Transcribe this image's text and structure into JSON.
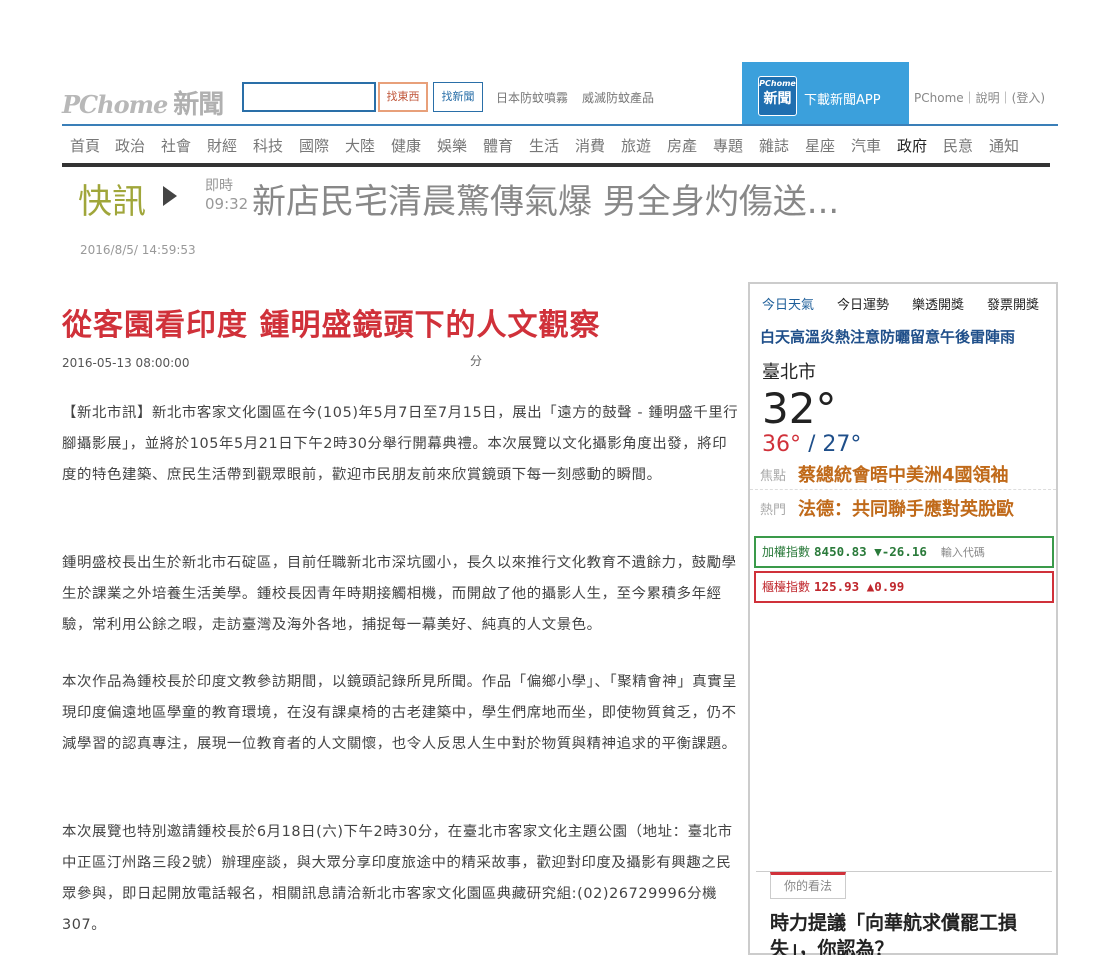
{
  "header": {
    "logo_text": "PChome",
    "logo_suffix": "新聞",
    "search_placeholder": "",
    "btn_shop": "找東西",
    "btn_news": "找新聞",
    "ad_links": [
      "日本防蚊噴霧",
      "威滅防蚊產品"
    ],
    "app_icon_top": "PChome",
    "app_icon_bottom": "新聞",
    "app_text": "下載新聞APP",
    "top_links": "PChome｜說明｜(登入)"
  },
  "nav": {
    "items": [
      "首頁",
      "政治",
      "社會",
      "財經",
      "科技",
      "國際",
      "大陸",
      "健康",
      "娛樂",
      "體育",
      "生活",
      "消費",
      "旅遊",
      "房產",
      "專題",
      "雜誌",
      "星座",
      "汽車",
      "政府",
      "民意",
      "通知"
    ],
    "active_index": 18
  },
  "flash": {
    "label": "快訊",
    "time_label": "即時",
    "time": "09:32",
    "headline": "新店民宅清晨驚傳氣爆 男全身灼傷送..."
  },
  "page_date": "2016/8/5/ 14:59:53",
  "article": {
    "title": "從客園看印度 鍾明盛鏡頭下的人文觀察",
    "date": "2016-05-13 08:00:00",
    "share_mark": "分",
    "paragraphs": [
      "【新北市訊】新北市客家文化園區在今(105)年5月7日至7月15日，展出「遠方的鼓聲 - 鍾明盛千里行腳攝影展」，並將於105年5月21日下午2時30分舉行開幕典禮。本次展覽以文化攝影角度出發，將印度的特色建築、庶民生活帶到觀眾眼前，歡迎市民朋友前來欣賞鏡頭下每一刻感動的瞬間。",
      "鍾明盛校長出生於新北市石碇區，目前任職新北市深坑國小，長久以來推行文化教育不遺餘力，鼓勵學生於課業之外培養生活美學。鍾校長因青年時期接觸相機，而開啟了他的攝影人生，至今累積多年經驗，常利用公餘之暇，走訪臺灣及海外各地，捕捉每一幕美好、純真的人文景色。",
      "本次作品為鍾校長於印度文教參訪期間，以鏡頭記錄所見所聞。作品「偏鄉小學」、「聚精會神」真實呈現印度偏遠地區學童的教育環境，在沒有課桌椅的古老建築中，學生們席地而坐，即使物質貧乏，仍不減學習的認真專注，展現一位教育者的人文關懷，也令人反思人生中對於物質與精神追求的平衡課題。",
      "本次展覽也特別邀請鍾校長於6月18日(六)下午2時30分，在臺北市客家文化主題公園（地址：臺北市中正區汀州路三段2號）辦理座談，與大眾分享印度旅途中的精采故事，歡迎對印度及攝影有興趣之民眾參與，即日起開放電話報名，相關訊息請洽新北市客家文化園區典藏研究組:(02)26729996分機307。"
    ]
  },
  "sidebar": {
    "tabs": [
      "今日天氣",
      "今日運勢",
      "樂透開獎",
      "發票開獎"
    ],
    "weather_alert": "白天高溫炎熱注意防曬留意午後雷陣雨",
    "city": "臺北市",
    "temp": "32°",
    "temp_high": "36°",
    "temp_sep": " / ",
    "temp_low": "27°",
    "news": [
      {
        "tag": "焦點",
        "text": "蔡總統會晤中美洲4國領袖"
      },
      {
        "tag": "熱門",
        "text": "法德：共同聯手應對英脫歐"
      }
    ],
    "stocks": [
      {
        "name": "加權指數",
        "value": "8450.83 ▼-26.16",
        "code": "輸入代碼",
        "color": "#2a7a3a"
      },
      {
        "name": "櫃檯指數",
        "value": "125.93 ▲0.99",
        "color": "#c0282e"
      }
    ],
    "opinion_tab": "你的看法",
    "opinion_question": "時力提議「向華航求償罷工損失」，你認為？"
  }
}
